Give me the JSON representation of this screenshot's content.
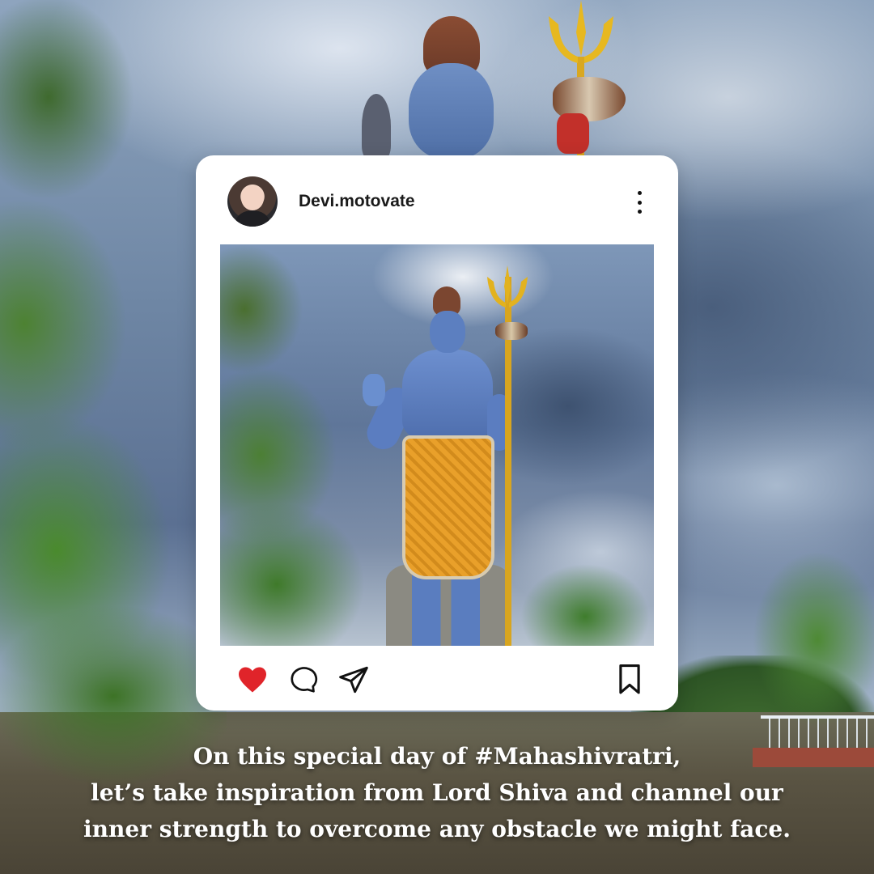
{
  "post": {
    "username": "Devi.motovate",
    "avatar_icon": "avatar-portrait",
    "more_icon": "more-vertical-icon",
    "photo_subject": "lord-shiva-statue",
    "liked": true,
    "like_color": "#e0242a",
    "actions": {
      "like_icon": "heart-icon",
      "comment_icon": "comment-icon",
      "share_icon": "send-icon",
      "save_icon": "bookmark-icon"
    }
  },
  "caption": {
    "lines": [
      "On this special day of #Mahashivratri,",
      "let’s take inspiration from Lord Shiva and channel our",
      "inner strength to overcome any obstacle we might face."
    ]
  }
}
